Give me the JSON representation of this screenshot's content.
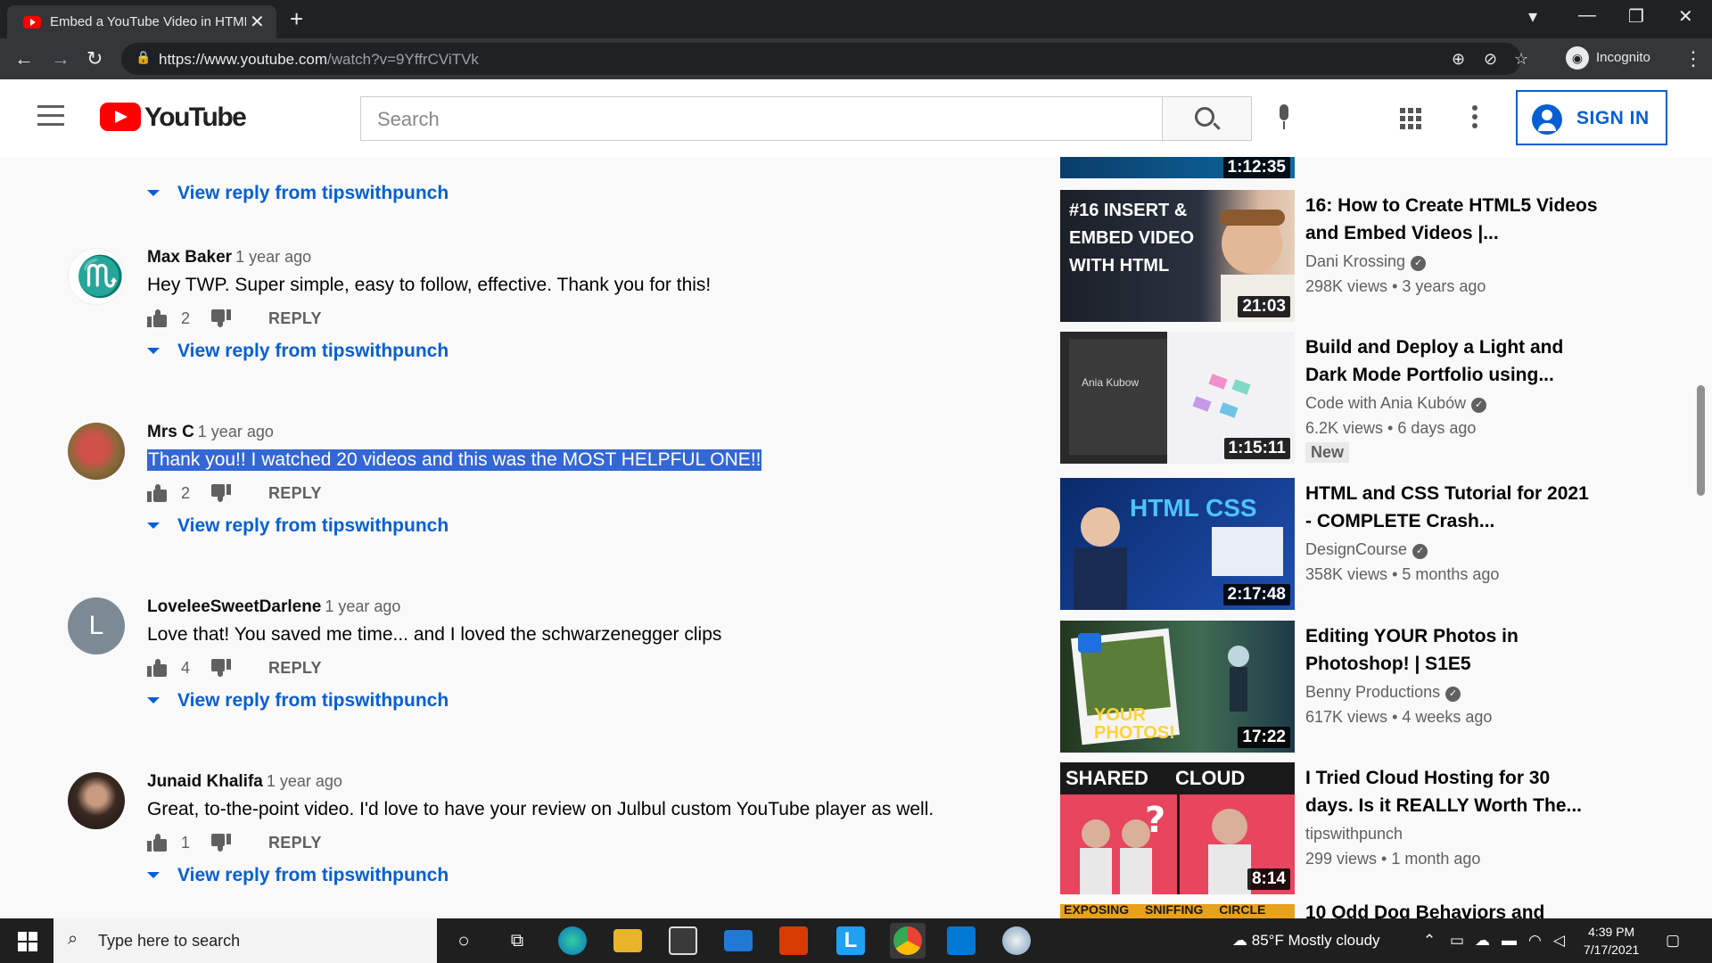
{
  "browser": {
    "tab_title": "Embed a YouTube Video in HTML",
    "url_domain": "https://www.youtube.com",
    "url_path": "/watch?v=9YffrCViTVk",
    "profile_label": "Incognito"
  },
  "youtube_header": {
    "logo_text": "YouTube",
    "search_placeholder": "Search",
    "sign_in_label": "SIGN IN"
  },
  "comments": [
    {
      "author": "Max Baker",
      "time": "1 year ago",
      "text": "Hey TWP. Super simple, easy to follow, effective. Thank you for this!",
      "likes": "2",
      "reply_label": "REPLY",
      "view_reply": "View reply from tipswithpunch",
      "selected": false
    },
    {
      "author": "Mrs C",
      "time": "1 year ago",
      "text": "Thank you!! I watched 20 videos and this was the MOST HELPFUL ONE!!",
      "likes": "2",
      "reply_label": "REPLY",
      "view_reply": "View reply from tipswithpunch",
      "selected": true
    },
    {
      "author": "LoveleeSweetDarlene",
      "time": "1 year ago",
      "text": "Love that! You saved me time... and I loved the schwarzenegger clips",
      "likes": "4",
      "reply_label": "REPLY",
      "view_reply": "View reply from tipswithpunch",
      "selected": false,
      "avatar_letter": "L"
    },
    {
      "author": "Junaid Khalifa",
      "time": "1 year ago",
      "text": "Great, to-the-point video. I'd love to have your review on Julbul custom YouTube player as well.",
      "likes": "1",
      "reply_label": "REPLY",
      "view_reply": "View reply from tipswithpunch",
      "selected": false
    }
  ],
  "top_partial": {
    "view_reply": "View reply from tipswithpunch",
    "reply_label": "REPLY"
  },
  "videos": [
    {
      "title": "16: How to Create HTML5 Videos and Embed Videos |...",
      "channel": "Dani Krossing",
      "verified": true,
      "views": "298K views",
      "age": "3 years ago",
      "duration": "21:03",
      "thumb_text": "#16 INSERT & EMBED VIDEO WITH HTML"
    },
    {
      "title": "Build and Deploy a Light and Dark Mode Portfolio using...",
      "channel": "Code with Ania Kubów",
      "verified": true,
      "views": "6.2K views",
      "age": "6 days ago",
      "duration": "1:15:11",
      "badge": "New",
      "thumb_text": "Ania Kubow"
    },
    {
      "title": "HTML and CSS Tutorial for 2021 - COMPLETE Crash...",
      "channel": "DesignCourse",
      "verified": true,
      "views": "358K views",
      "age": "5 months ago",
      "duration": "2:17:48",
      "thumb_text": "HTML CSS"
    },
    {
      "title": "Editing YOUR Photos in Photoshop! | S1E5",
      "channel": "Benny Productions",
      "verified": true,
      "views": "617K views",
      "age": "4 weeks ago",
      "duration": "17:22",
      "thumb_text": "YOUR PHOTOS!"
    },
    {
      "title": "I Tried Cloud Hosting for 30 days. Is it REALLY Worth The...",
      "channel": "tipswithpunch",
      "verified": false,
      "views": "299 views",
      "age": "1 month ago",
      "duration": "8:14",
      "thumb_text": "SHARED CLOUD"
    },
    {
      "title": "10 Odd Dog Behaviors and",
      "thumb_text": "EXPOSING SNIFFING CIRCLE"
    }
  ],
  "partial_top_video": {
    "duration": "1:12:35"
  },
  "taskbar": {
    "search_placeholder": "Type here to search",
    "weather": "85°F  Mostly cloudy",
    "time": "4:39 PM",
    "date": "7/17/2021"
  }
}
